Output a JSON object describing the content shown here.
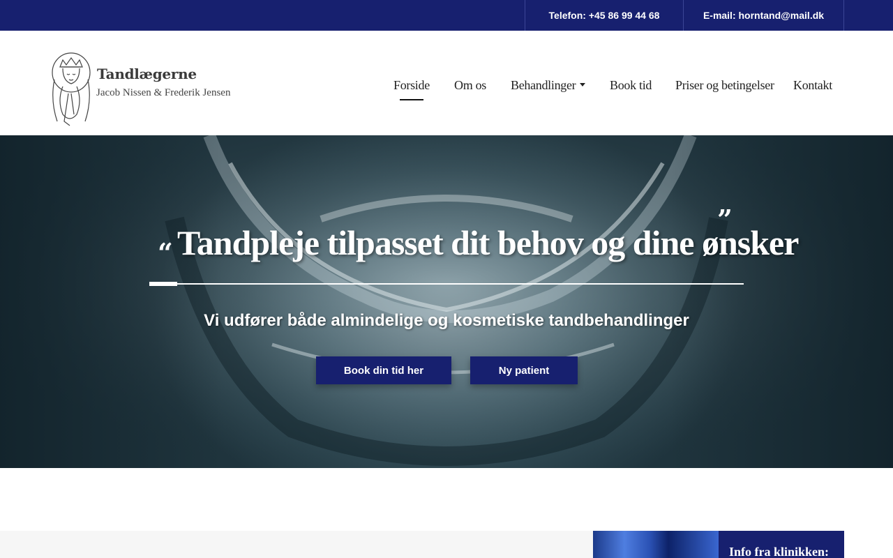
{
  "topbar": {
    "phone": "Telefon: +45 86 99 44 68",
    "email": "E-mail: horntand@mail.dk"
  },
  "brand": {
    "title": "Tandlægerne",
    "subtitle": "Jacob Nissen & Frederik Jensen"
  },
  "nav": {
    "items": [
      {
        "label": "Forside",
        "active": true
      },
      {
        "label": "Om os"
      },
      {
        "label": "Behandlinger",
        "has_dropdown": true
      },
      {
        "label": "Book tid"
      },
      {
        "label": "Priser og betingelser"
      },
      {
        "label": "Kontakt"
      }
    ]
  },
  "hero": {
    "quote_open": "“",
    "quote_close": "”",
    "title": "Tandpleje tilpasset dit behov og dine ønsker",
    "subtitle": "Vi udfører både almindelige og kosmetiske tandbehandlinger",
    "book_button": "Book din tid her",
    "new_patient_button": "Ny patient"
  },
  "info": {
    "title": "Info fra klinikken:"
  },
  "colors": {
    "brand_navy": "#17206f",
    "white": "#ffffff"
  }
}
